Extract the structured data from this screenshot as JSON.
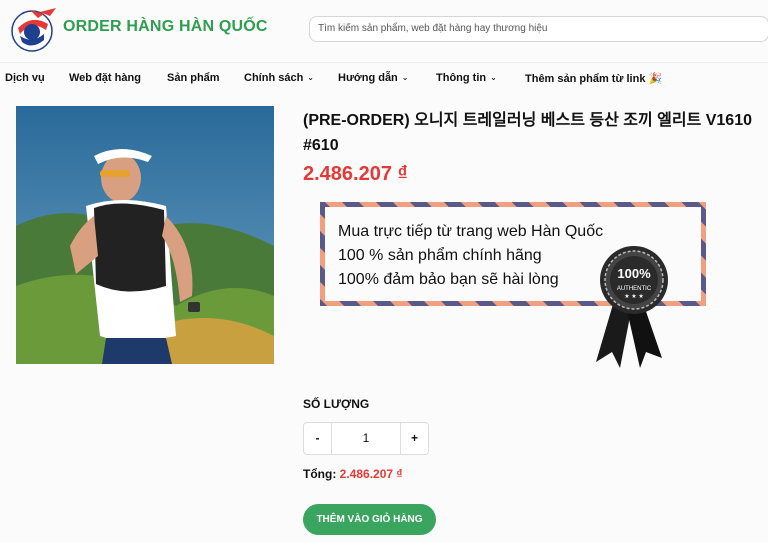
{
  "header": {
    "brand": "ORDER HÀNG HÀN QUỐC",
    "search_placeholder": "Tìm kiếm sản phẩm, web đặt hàng hay thương hiệu"
  },
  "nav": [
    {
      "label": "Dịch vụ"
    },
    {
      "label": "Web đặt hàng"
    },
    {
      "label": "Sản phẩm"
    },
    {
      "label": "Chính sách",
      "dropdown": true
    },
    {
      "label": "Hướng dẫn",
      "dropdown": true
    },
    {
      "label": "Thông tin",
      "dropdown": true
    },
    {
      "label": "Thêm sản phẩm từ link 🎉"
    }
  ],
  "product": {
    "title": "(PRE-ORDER) 오니지 트레일러닝 베스트 등산 조끼 엘리트 V1610 #610",
    "price": "2.486.207 ₫"
  },
  "promo": {
    "lines": [
      "Mua trực tiếp từ trang web Hàn Quốc",
      "100 % sản phẩm chính hãng",
      "100% đảm bảo bạn sẽ hài lòng"
    ],
    "seal_number": "100%",
    "seal_text": "AUTHENTIC"
  },
  "quantity": {
    "label": "SỐ LƯỢNG",
    "minus": "-",
    "value": "1",
    "plus": "+"
  },
  "total": {
    "label": "Tổng:",
    "value": "2.486.207 ₫"
  },
  "add_to_cart": "THÊM VÀO GIỎ HÀNG",
  "colors": {
    "brand_green": "#2e9e4f",
    "price_red": "#e53935",
    "button_green": "#3aa55e"
  }
}
